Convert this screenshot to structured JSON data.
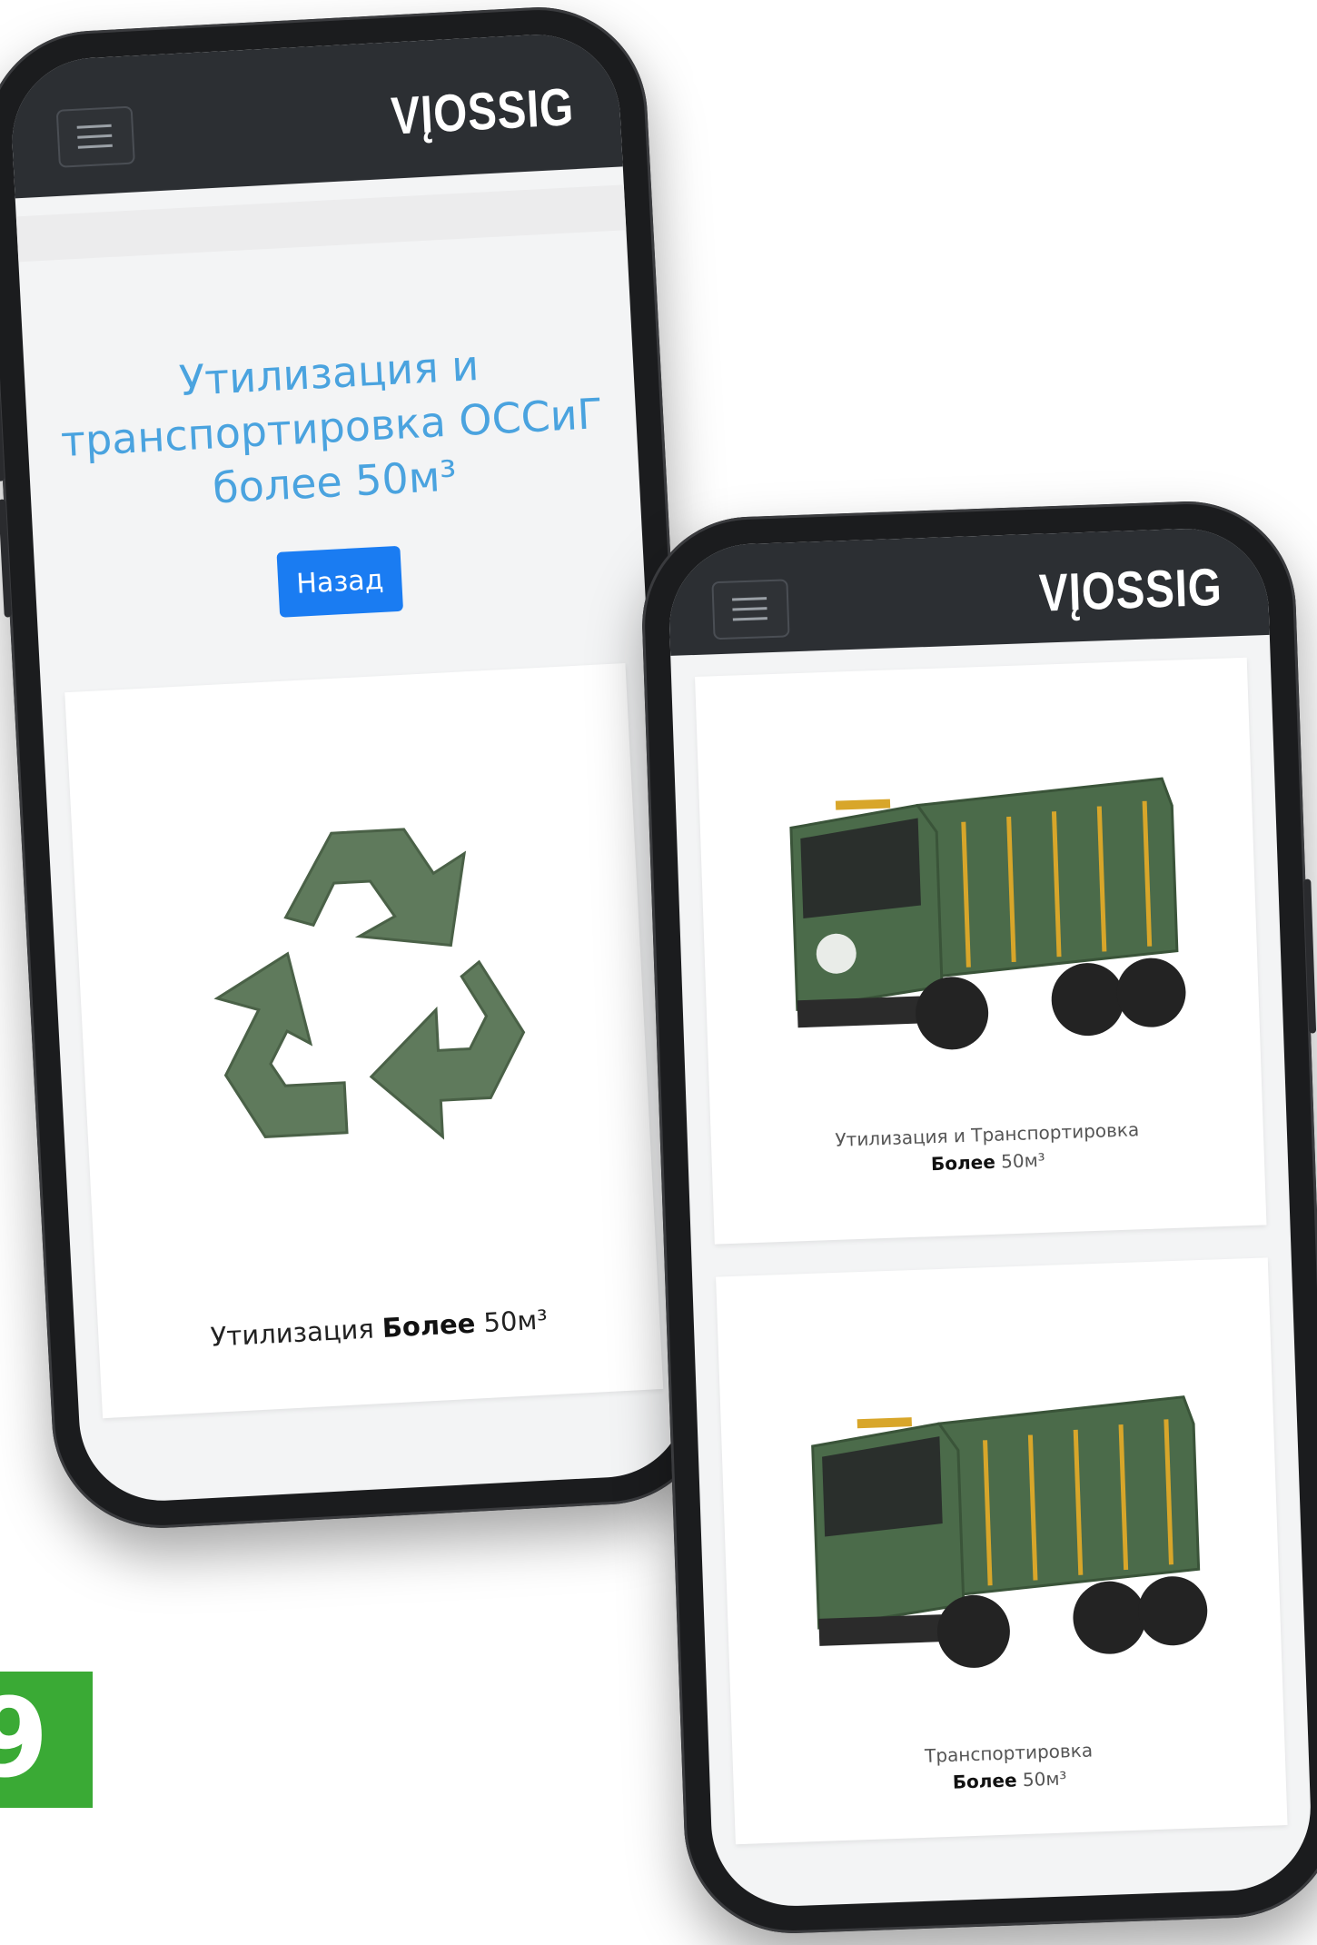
{
  "brand": {
    "logo": "VĮOSSIG"
  },
  "left_screen": {
    "title_line1": "Утилизация и",
    "title_line2": "транспортировка ОССиГ",
    "title_line3": "более 50м³",
    "back_label": "Назад",
    "card": {
      "caption_prefix": "Утилизация",
      "caption_bold": "Более",
      "caption_suffix": "50м³"
    }
  },
  "right_screen": {
    "cards": [
      {
        "caption_line1": "Утилизация и Транспортировка",
        "caption_bold": "Более",
        "caption_suffix": "50м³"
      },
      {
        "caption_line1": "Транспортировка",
        "caption_bold": "Более",
        "caption_suffix": "50м³"
      }
    ]
  },
  "badge": {
    "text": "9"
  },
  "colors": {
    "accent": "#4aa3df",
    "button": "#1a7cf2",
    "header": "#2c2f33",
    "truck": "#4b6b4a",
    "recycle": "#5f7a5c",
    "badge": "#3aaa35"
  }
}
